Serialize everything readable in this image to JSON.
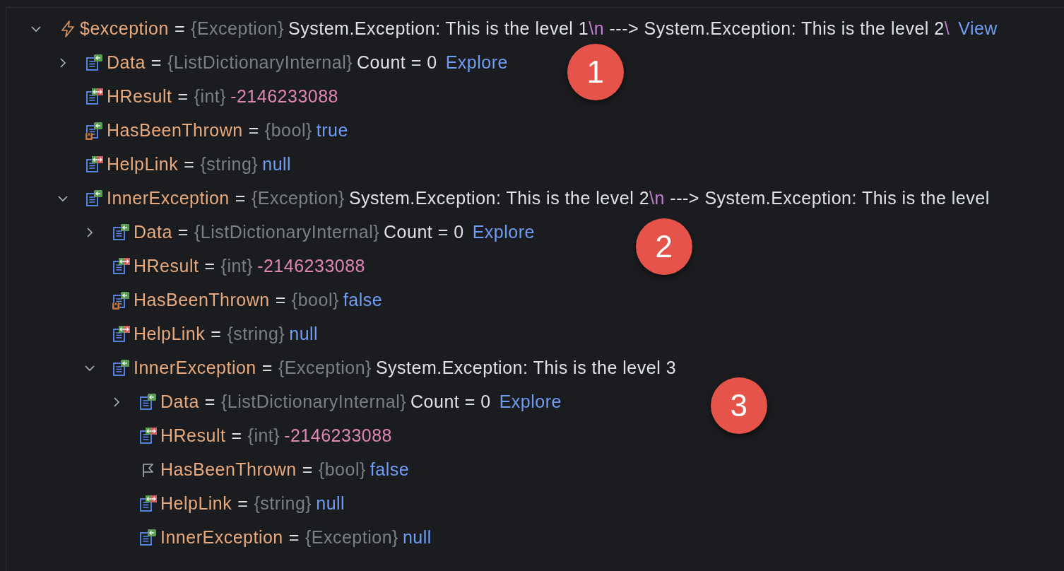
{
  "tree": [
    {
      "name": "$exception",
      "kind": "exception",
      "op": "=",
      "type": "{Exception}",
      "expanded": true,
      "value": [
        {
          "kind": "text",
          "text": "System.Exception: This is the level 1"
        },
        {
          "kind": "escape",
          "text": "\\n"
        },
        {
          "kind": "text",
          "text": " ---> System.Exception: This is the level 2"
        },
        {
          "kind": "escape",
          "text": "\\"
        }
      ],
      "link": "View",
      "children": [
        {
          "name": "Data",
          "kind": "in",
          "op": "=",
          "type": "{ListDictionaryInternal}",
          "expanded": false,
          "value": [
            {
              "kind": "text",
              "text": "Count = 0"
            }
          ],
          "link": "Explore"
        },
        {
          "name": "HResult",
          "kind": "inout",
          "op": "=",
          "type": "{int}",
          "value": [
            {
              "kind": "number",
              "text": "-2146233088"
            }
          ]
        },
        {
          "name": "HasBeenThrown",
          "kind": "locked",
          "op": "=",
          "type": "{bool}",
          "value": [
            {
              "kind": "keyword",
              "text": "true"
            }
          ]
        },
        {
          "name": "HelpLink",
          "kind": "inout",
          "op": "=",
          "type": "{string}",
          "value": [
            {
              "kind": "keyword",
              "text": "null"
            }
          ]
        },
        {
          "name": "InnerException",
          "kind": "in",
          "op": "=",
          "type": "{Exception}",
          "expanded": true,
          "value": [
            {
              "kind": "text",
              "text": "System.Exception: This is the level 2"
            },
            {
              "kind": "escape",
              "text": "\\n"
            },
            {
              "kind": "text",
              "text": " ---> System.Exception: This is the level"
            }
          ],
          "children": [
            {
              "name": "Data",
              "kind": "in",
              "op": "=",
              "type": "{ListDictionaryInternal}",
              "expanded": false,
              "value": [
                {
                  "kind": "text",
                  "text": "Count = 0"
                }
              ],
              "link": "Explore"
            },
            {
              "name": "HResult",
              "kind": "inout",
              "op": "=",
              "type": "{int}",
              "value": [
                {
                  "kind": "number",
                  "text": "-2146233088"
                }
              ]
            },
            {
              "name": "HasBeenThrown",
              "kind": "locked",
              "op": "=",
              "type": "{bool}",
              "value": [
                {
                  "kind": "keyword",
                  "text": "false"
                }
              ]
            },
            {
              "name": "HelpLink",
              "kind": "inout",
              "op": "=",
              "type": "{string}",
              "value": [
                {
                  "kind": "keyword",
                  "text": "null"
                }
              ]
            },
            {
              "name": "InnerException",
              "kind": "in",
              "op": "=",
              "type": "{Exception}",
              "expanded": true,
              "value": [
                {
                  "kind": "text",
                  "text": "System.Exception: This is the level 3"
                }
              ],
              "children": [
                {
                  "name": "Data",
                  "kind": "in",
                  "op": "=",
                  "type": "{ListDictionaryInternal}",
                  "expanded": false,
                  "value": [
                    {
                      "kind": "text",
                      "text": "Count = 0"
                    }
                  ],
                  "link": "Explore"
                },
                {
                  "name": "HResult",
                  "kind": "inout",
                  "op": "=",
                  "type": "{int}",
                  "value": [
                    {
                      "kind": "number",
                      "text": "-2146233088"
                    }
                  ]
                },
                {
                  "name": "HasBeenThrown",
                  "kind": "flag",
                  "op": "=",
                  "type": "{bool}",
                  "value": [
                    {
                      "kind": "keyword",
                      "text": "false"
                    }
                  ]
                },
                {
                  "name": "HelpLink",
                  "kind": "inout",
                  "op": "=",
                  "type": "{string}",
                  "value": [
                    {
                      "kind": "keyword",
                      "text": "null"
                    }
                  ]
                },
                {
                  "name": "InnerException",
                  "kind": "in",
                  "op": "=",
                  "type": "{Exception}",
                  "value": [
                    {
                      "kind": "keyword",
                      "text": "null"
                    }
                  ]
                }
              ]
            }
          ]
        }
      ]
    }
  ],
  "callouts": [
    {
      "label": "1"
    },
    {
      "label": "2"
    },
    {
      "label": "3"
    }
  ]
}
